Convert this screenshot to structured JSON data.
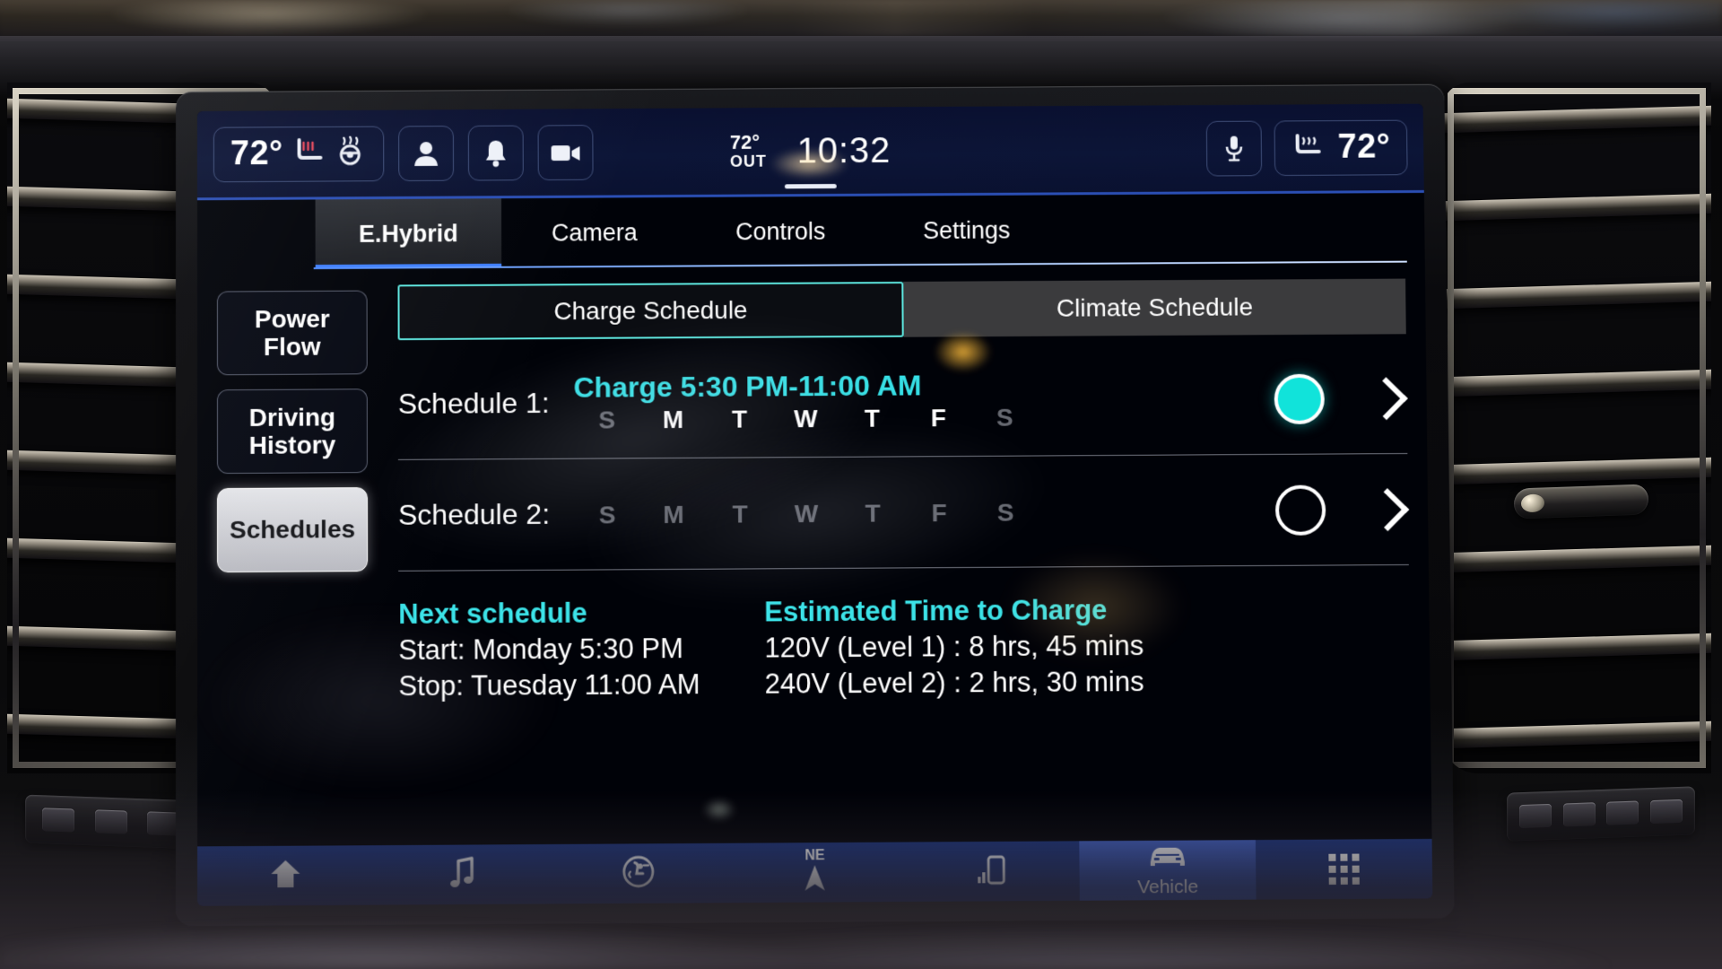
{
  "statusbar": {
    "cabin_temp_left": "72°",
    "seat_heat_icon": "heated-seat-icon",
    "steering_heat_icon": "heated-steering-wheel-icon",
    "profile_icon": "user-profile-icon",
    "notification_icon": "bell-icon",
    "camera_icon": "video-camera-icon",
    "outside_temp": "72°",
    "outside_label": "OUT",
    "clock": "10:32",
    "mic_icon": "microphone-icon",
    "vent_seat_icon": "ventilated-seat-icon",
    "cabin_temp_right": "72°"
  },
  "tabs": [
    {
      "label": "E.Hybrid",
      "active": true
    },
    {
      "label": "Camera",
      "active": false
    },
    {
      "label": "Controls",
      "active": false
    },
    {
      "label": "Settings",
      "active": false
    }
  ],
  "sidebar": {
    "items": [
      {
        "label": "Power\nFlow",
        "selected": false
      },
      {
        "label": "Driving\nHistory",
        "selected": false
      },
      {
        "label": "Schedules",
        "selected": true
      }
    ]
  },
  "segmented": {
    "charge": "Charge Schedule",
    "climate": "Climate Schedule",
    "active": "charge"
  },
  "schedules": [
    {
      "label": "Schedule 1:",
      "charge_text": "Charge 5:30 PM-11:00 AM",
      "days": [
        {
          "letter": "S",
          "on": false
        },
        {
          "letter": "M",
          "on": true
        },
        {
          "letter": "T",
          "on": true
        },
        {
          "letter": "W",
          "on": true
        },
        {
          "letter": "T",
          "on": true
        },
        {
          "letter": "F",
          "on": true
        },
        {
          "letter": "S",
          "on": false
        }
      ],
      "enabled": true
    },
    {
      "label": "Schedule 2:",
      "charge_text": "",
      "days": [
        {
          "letter": "S",
          "on": false
        },
        {
          "letter": "M",
          "on": false
        },
        {
          "letter": "T",
          "on": false
        },
        {
          "letter": "W",
          "on": false
        },
        {
          "letter": "T",
          "on": false
        },
        {
          "letter": "F",
          "on": false
        },
        {
          "letter": "S",
          "on": false
        }
      ],
      "enabled": false
    }
  ],
  "next_schedule": {
    "heading": "Next schedule",
    "start": "Start: Monday 5:30 PM",
    "stop": "Stop: Tuesday 11:00 AM"
  },
  "estimated_charge": {
    "heading": "Estimated Time to Charge",
    "level1": "120V (Level 1) : 8 hrs, 45 mins",
    "level2": "240V (Level 2) : 2 hrs, 30 mins"
  },
  "navbar": {
    "items": [
      {
        "icon": "home-icon",
        "label": "",
        "active": false
      },
      {
        "icon": "music-note-icon",
        "label": "",
        "active": false
      },
      {
        "icon": "climate-seat-icon",
        "label": "",
        "active": false
      },
      {
        "icon": "navigation-arrow-icon",
        "label": "",
        "heading": "NE",
        "active": false
      },
      {
        "icon": "phone-signal-icon",
        "label": "",
        "active": false
      },
      {
        "icon": "car-icon",
        "label": "Vehicle",
        "active": true
      },
      {
        "icon": "apps-grid-icon",
        "label": "",
        "active": false
      }
    ]
  },
  "colors": {
    "accent_cyan": "#36e0e6",
    "toggle_on": "#11e3da",
    "tab_underline": "#3f7fff",
    "navbar_blue": "#1b347f"
  }
}
